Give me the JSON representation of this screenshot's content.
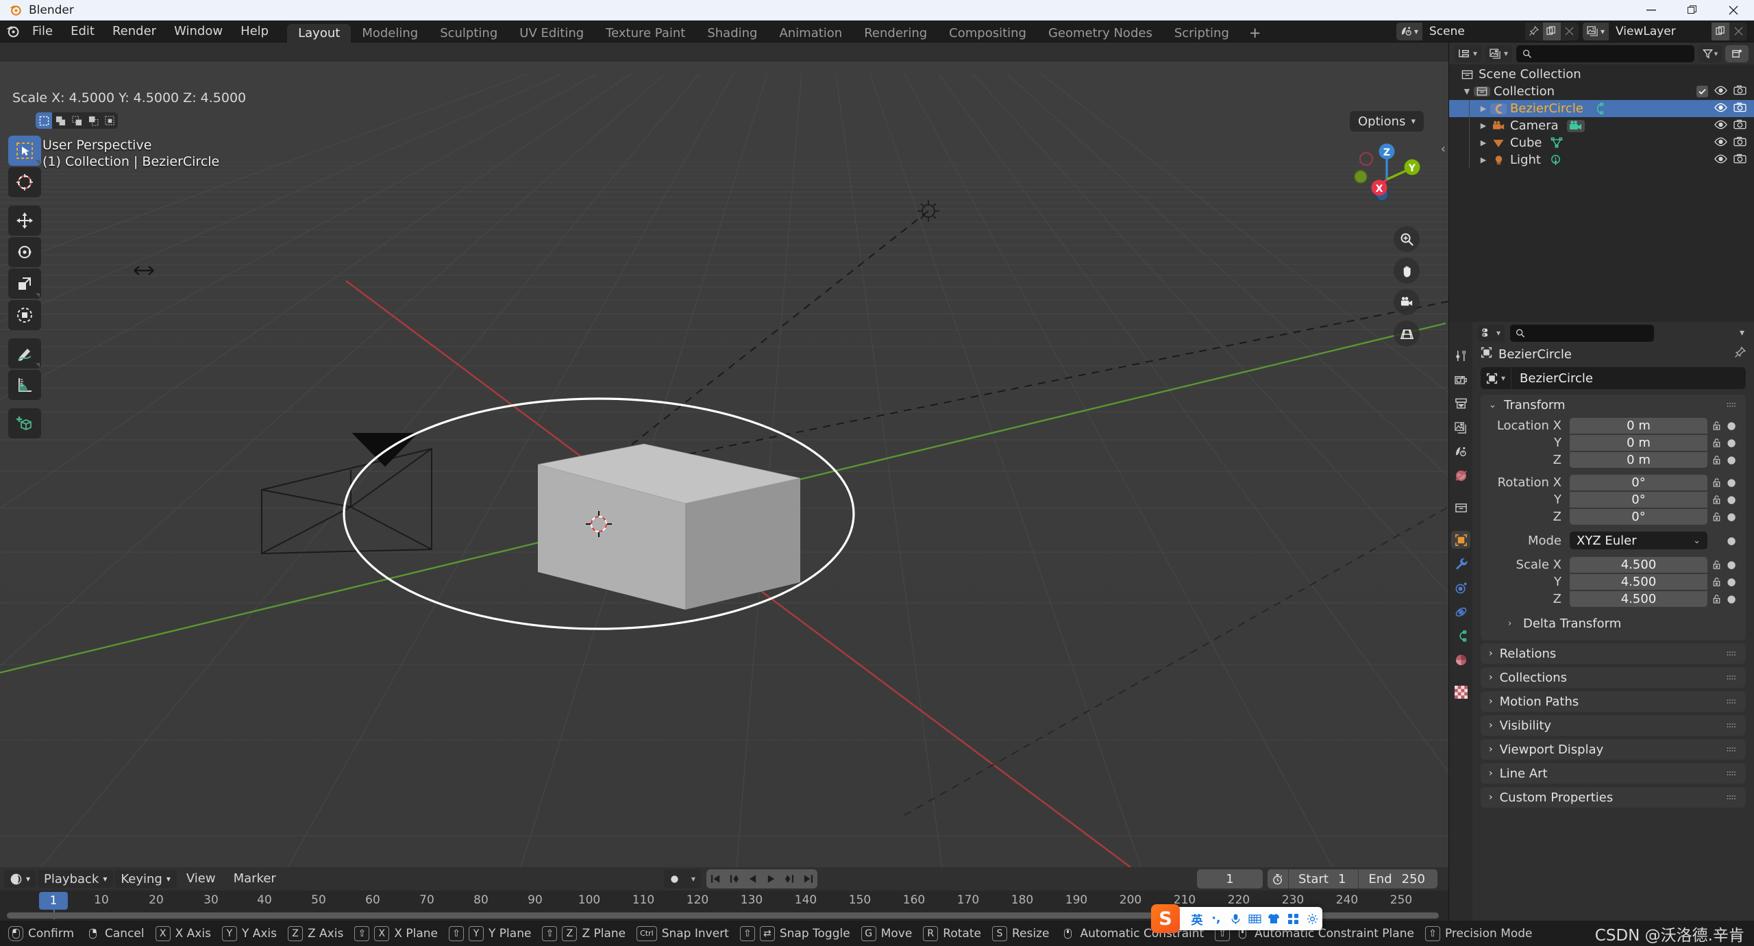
{
  "window": {
    "title": "Blender",
    "minimize_label": "—",
    "restore_label": "❐",
    "close_label": "✕"
  },
  "topbar": {
    "menus": [
      "File",
      "Edit",
      "Render",
      "Window",
      "Help"
    ],
    "workspace_tabs": [
      {
        "label": "Layout",
        "active": true
      },
      {
        "label": "Modeling",
        "active": false
      },
      {
        "label": "Sculpting",
        "active": false
      },
      {
        "label": "UV Editing",
        "active": false
      },
      {
        "label": "Texture Paint",
        "active": false
      },
      {
        "label": "Shading",
        "active": false
      },
      {
        "label": "Animation",
        "active": false
      },
      {
        "label": "Rendering",
        "active": false
      },
      {
        "label": "Compositing",
        "active": false
      },
      {
        "label": "Geometry Nodes",
        "active": false
      },
      {
        "label": "Scripting",
        "active": false
      }
    ],
    "add_tab_label": "+",
    "scene": {
      "name": "Scene",
      "icon": "scene-icon",
      "pin_icon": "pin-icon",
      "copy_icon": "duplicate-icon",
      "remove_icon": "x-icon"
    },
    "viewlayer": {
      "name": "ViewLayer",
      "icon": "viewlayer-icon",
      "copy_icon": "duplicate-icon",
      "remove_icon": "x-icon"
    }
  },
  "viewport": {
    "scale_status": "Scale X: 4.5000   Y: 4.5000  Z: 4.5000",
    "perspective_label": "User Perspective",
    "context_label": "(1) Collection | BezierCircle",
    "options_label": "Options",
    "select_modes": [
      "select-box-icon",
      "select-extend-icon",
      "select-subtract-icon",
      "select-invert-icon",
      "select-intersect-icon"
    ],
    "tools": [
      {
        "name": "tweak-tool",
        "active": true
      },
      {
        "name": "cursor-tool",
        "active": false
      },
      {
        "name": "move-tool",
        "active": false
      },
      {
        "name": "rotate-tool",
        "active": false
      },
      {
        "name": "scale-tool",
        "active": false
      },
      {
        "name": "transform-tool",
        "active": false
      },
      {
        "name": "annotate-tool",
        "active": false
      },
      {
        "name": "measure-tool",
        "active": false
      },
      {
        "name": "add-cube-tool",
        "active": false
      }
    ],
    "gizmo_axes": [
      {
        "label": "Z",
        "color": "#3b86d4"
      },
      {
        "label": "Y",
        "color": "#7fb800"
      },
      {
        "label": "X",
        "color": "#e8344a"
      }
    ],
    "nav_buttons": [
      "zoom-icon",
      "pan-hand-icon",
      "camera-view-icon",
      "orthographic-toggle-icon"
    ],
    "collapse_icon": "chevron-left-icon"
  },
  "outliner": {
    "display_mode_icon": "outliner-display-mode-icon",
    "scene_filter_icon": "viewlayer-icon",
    "search_placeholder": "",
    "search_value": "",
    "filter_icon": "filter-funnel-icon",
    "new_collection_icon": "new-collection-icon",
    "rows": [
      {
        "name": "Scene Collection",
        "icon": "collection-icon",
        "level": 0,
        "selected": false,
        "expandable": false,
        "checkbox": false,
        "eye": false,
        "camera": false
      },
      {
        "name": "Collection",
        "icon": "collection-icon",
        "level": 1,
        "selected": false,
        "expandable": true,
        "expanded": true,
        "checkbox": true,
        "eye": true,
        "camera": true
      },
      {
        "name": "BezierCircle",
        "icon": "curve-object-icon",
        "data_icon": "curve-data-icon",
        "level": 2,
        "selected": true,
        "expandable": true,
        "expanded": false,
        "checkbox": false,
        "eye": true,
        "camera": true
      },
      {
        "name": "Camera",
        "icon": "camera-object-icon",
        "data_icon": "camera-data-icon",
        "level": 2,
        "selected": false,
        "expandable": true,
        "expanded": false,
        "checkbox": false,
        "eye": true,
        "camera": true
      },
      {
        "name": "Cube",
        "icon": "mesh-object-icon",
        "data_icon": "mesh-data-icon",
        "level": 2,
        "selected": false,
        "expandable": true,
        "expanded": false,
        "checkbox": false,
        "eye": true,
        "camera": true
      },
      {
        "name": "Light",
        "icon": "light-object-icon",
        "data_icon": "light-data-icon",
        "level": 2,
        "selected": false,
        "expandable": true,
        "expanded": false,
        "checkbox": false,
        "eye": true,
        "camera": true
      }
    ]
  },
  "properties": {
    "editor_type_icon": "properties-editor-icon",
    "search_placeholder": "",
    "tabs": [
      {
        "name": "tool-tab",
        "icon": "tool-icon",
        "active": false
      },
      {
        "name": "render-tab",
        "icon": "render-camera-icon",
        "active": false
      },
      {
        "name": "output-tab",
        "icon": "printer-icon",
        "active": false
      },
      {
        "name": "viewlayer-tab",
        "icon": "images-icon",
        "active": false
      },
      {
        "name": "scene-tab",
        "icon": "scene-cone-icon",
        "active": false
      },
      {
        "name": "world-tab",
        "icon": "world-globe-icon",
        "active": false
      },
      {
        "name": "collection-tab",
        "icon": "collection-icon",
        "active": false
      },
      {
        "name": "object-tab",
        "icon": "object-square-icon",
        "active": true
      },
      {
        "name": "modifiers-tab",
        "icon": "wrench-icon",
        "active": false
      },
      {
        "name": "particles-tab",
        "icon": "particles-icon",
        "active": false
      },
      {
        "name": "physics-tab",
        "icon": "physics-orbit-icon",
        "active": false
      },
      {
        "name": "constraints-tab",
        "icon": "object-constraints-icon",
        "active": false
      },
      {
        "name": "data-tab",
        "icon": "curve-data-pie-icon",
        "active": false
      },
      {
        "name": "material-tab",
        "icon": "material-checker-icon",
        "active": false
      }
    ],
    "breadcrumb": "BezierCircle",
    "pin_icon": "pin-icon",
    "object_name": "BezierCircle",
    "transform_panel": {
      "title": "Transform",
      "location": {
        "label": "Location X",
        "labels": [
          "Location X",
          "Y",
          "Z"
        ],
        "values": [
          "0 m",
          "0 m",
          "0 m"
        ]
      },
      "rotation": {
        "labels": [
          "Rotation X",
          "Y",
          "Z"
        ],
        "values": [
          "0°",
          "0°",
          "0°"
        ]
      },
      "mode": {
        "label": "Mode",
        "value": "XYZ Euler"
      },
      "scale": {
        "labels": [
          "Scale X",
          "Y",
          "Z"
        ],
        "values": [
          "4.500",
          "4.500",
          "4.500"
        ]
      }
    },
    "sub_panel": "Delta Transform",
    "closed_panels": [
      "Relations",
      "Collections",
      "Motion Paths",
      "Visibility",
      "Viewport Display",
      "Line Art",
      "Custom Properties"
    ]
  },
  "timeline": {
    "editor_icon": "timeline-editor-icon",
    "menus": [
      {
        "label": "Playback",
        "dropdown": true
      },
      {
        "label": "Keying",
        "dropdown": true
      },
      {
        "label": "View",
        "dropdown": false
      },
      {
        "label": "Marker",
        "dropdown": false
      }
    ],
    "record_icon": "record-keyframe-icon",
    "playback_buttons": [
      "jump-to-start-icon",
      "prev-keyframe-icon",
      "play-reverse-icon",
      "play-icon",
      "next-keyframe-icon",
      "jump-to-end-icon"
    ],
    "current_frame": "1",
    "timer_icon": "stopwatch-icon",
    "start_label": "Start",
    "start_value": "1",
    "end_label": "End",
    "end_value": "250",
    "ticks": [
      "10",
      "20",
      "30",
      "40",
      "50",
      "60",
      "70",
      "80",
      "90",
      "100",
      "110",
      "120",
      "130",
      "140",
      "150",
      "160",
      "170",
      "180",
      "190",
      "200",
      "210",
      "220",
      "230",
      "240",
      "250"
    ],
    "playhead_label": "1"
  },
  "statusbar": {
    "hints": [
      {
        "keys": [
          "mouse-left-icon"
        ],
        "label": "Confirm"
      },
      {
        "keys": [
          "mouse-right-icon"
        ],
        "label": "Cancel"
      },
      {
        "keys": [
          "X"
        ],
        "label": "X Axis"
      },
      {
        "keys": [
          "Y"
        ],
        "label": "Y Axis"
      },
      {
        "keys": [
          "Z"
        ],
        "label": "Z Axis"
      },
      {
        "keys": [
          "⇧",
          "X"
        ],
        "label": "X Plane"
      },
      {
        "keys": [
          "⇧",
          "Y"
        ],
        "label": "Y Plane"
      },
      {
        "keys": [
          "⇧",
          "Z"
        ],
        "label": "Z Plane"
      },
      {
        "keys": [
          "Ctrl"
        ],
        "label": "Snap Invert"
      },
      {
        "keys": [
          "⇧",
          "⇄"
        ],
        "label": "Snap Toggle"
      },
      {
        "keys": [
          "G"
        ],
        "label": "Move"
      },
      {
        "keys": [
          "R"
        ],
        "label": "Rotate"
      },
      {
        "keys": [
          "S"
        ],
        "label": "Resize"
      },
      {
        "keys": [
          "mouse-middle-icon"
        ],
        "label": "Automatic Constraint"
      },
      {
        "keys": [
          "⇧",
          "mouse-middle-icon"
        ],
        "label": "Automatic Constraint Plane"
      },
      {
        "keys": [
          "⇧"
        ],
        "label": "Precision Mode"
      }
    ],
    "watermark": "CSDN @沃洛德.辛肯"
  },
  "ime": {
    "logo": "S",
    "buttons": [
      "英",
      "·,",
      "mic-icon",
      "keyboard-icon",
      "skin-icon",
      "apps-icon",
      "settings-icon"
    ]
  }
}
